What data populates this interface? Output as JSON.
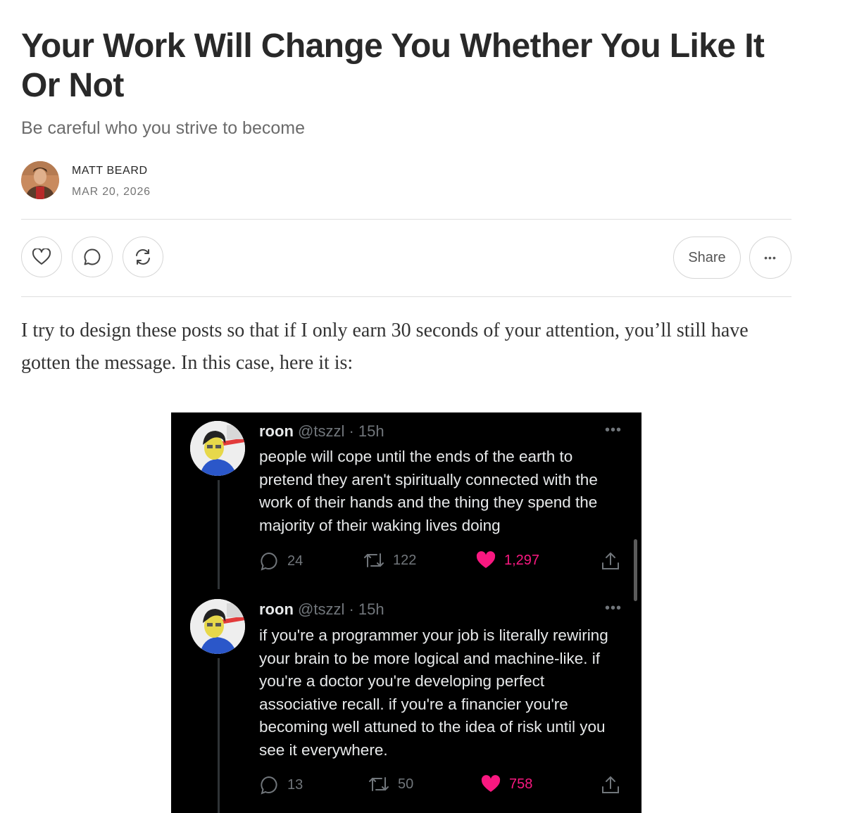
{
  "article": {
    "title": "Your Work Will Change You Whether You Like It Or Not",
    "subtitle": "Be careful who you strive to become",
    "author": "MATT BEARD",
    "date": "MAR 20, 2026",
    "share_label": "Share",
    "more_label": "•••",
    "body": "I try to design these posts so that if I only earn 30 seconds of your attention, you’ll still have gotten the message. In this case, here it is:"
  },
  "tweets": [
    {
      "name": "roon",
      "handle": "@tszzl",
      "time": "· 15h",
      "text": "people will cope until the ends of the earth to pretend they aren't spiritually connected with the work of their hands and the thing they spend the majority of their waking lives doing",
      "replies": "24",
      "retweets": "122",
      "likes": "1,297"
    },
    {
      "name": "roon",
      "handle": "@tszzl",
      "time": "· 15h",
      "text": "if you're a programmer your job is literally rewiring your brain to be more logical and machine-like. if you're a doctor you're developing perfect associative recall. if you're a financier you're becoming well attuned to the idea of risk until you see it everywhere.",
      "replies": "13",
      "retweets": "50",
      "likes": "758"
    }
  ],
  "colors": {
    "like": "#f91880",
    "tweet_bg": "#000000",
    "title": "#292929"
  }
}
